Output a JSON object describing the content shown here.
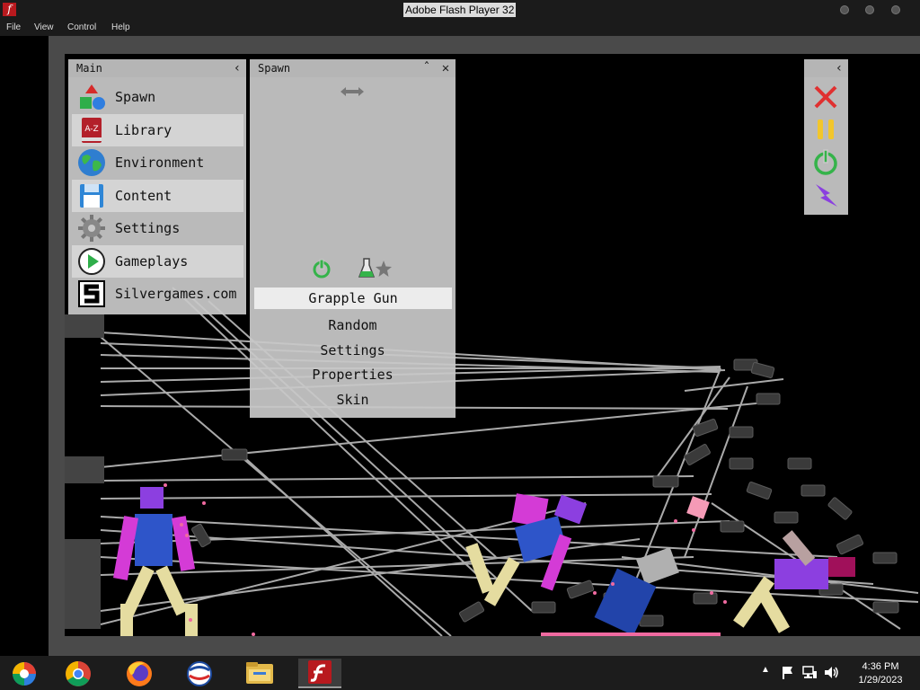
{
  "window": {
    "title": "Adobe Flash Player 32"
  },
  "menu": {
    "file": "File",
    "view": "View",
    "control": "Control",
    "help": "Help"
  },
  "main_panel": {
    "title": "Main",
    "items": [
      {
        "label": "Spawn",
        "icon": "shapes-icon"
      },
      {
        "label": "Library",
        "icon": "book-icon"
      },
      {
        "label": "Environment",
        "icon": "globe-icon"
      },
      {
        "label": "Content",
        "icon": "floppy-disk-icon"
      },
      {
        "label": "Settings",
        "icon": "gear-icon"
      },
      {
        "label": "Gameplays",
        "icon": "play-icon"
      },
      {
        "label": "Silvergames.com",
        "icon": "silvergames-logo-icon"
      }
    ],
    "library_icon_text": "A-Z"
  },
  "spawn_panel": {
    "title": "Spawn",
    "selected": "Grapple Gun",
    "options": [
      "Random",
      "Settings",
      "Properties",
      "Skin"
    ]
  },
  "tools_panel": {
    "tools": [
      "close-tool-icon",
      "pause-icon",
      "power-icon",
      "lightning-icon"
    ]
  },
  "taskbar": {
    "apps": [
      "app-launcher-icon",
      "chrome-icon",
      "firefox-icon",
      "browser-icon",
      "file-explorer-icon",
      "flash-player-icon"
    ],
    "time": "4:36 PM",
    "date": "1/29/2023"
  },
  "colors": {
    "panel": "#c8c8c8",
    "panel_header": "#b5b5b5",
    "stage": "#000000",
    "frame": "#4a4a4a",
    "flash_red": "#b8191e",
    "close_red": "#e03030",
    "pause_yellow": "#f2c62b",
    "power_green": "#35b34a",
    "lightning_purple": "#8a3fe0"
  }
}
